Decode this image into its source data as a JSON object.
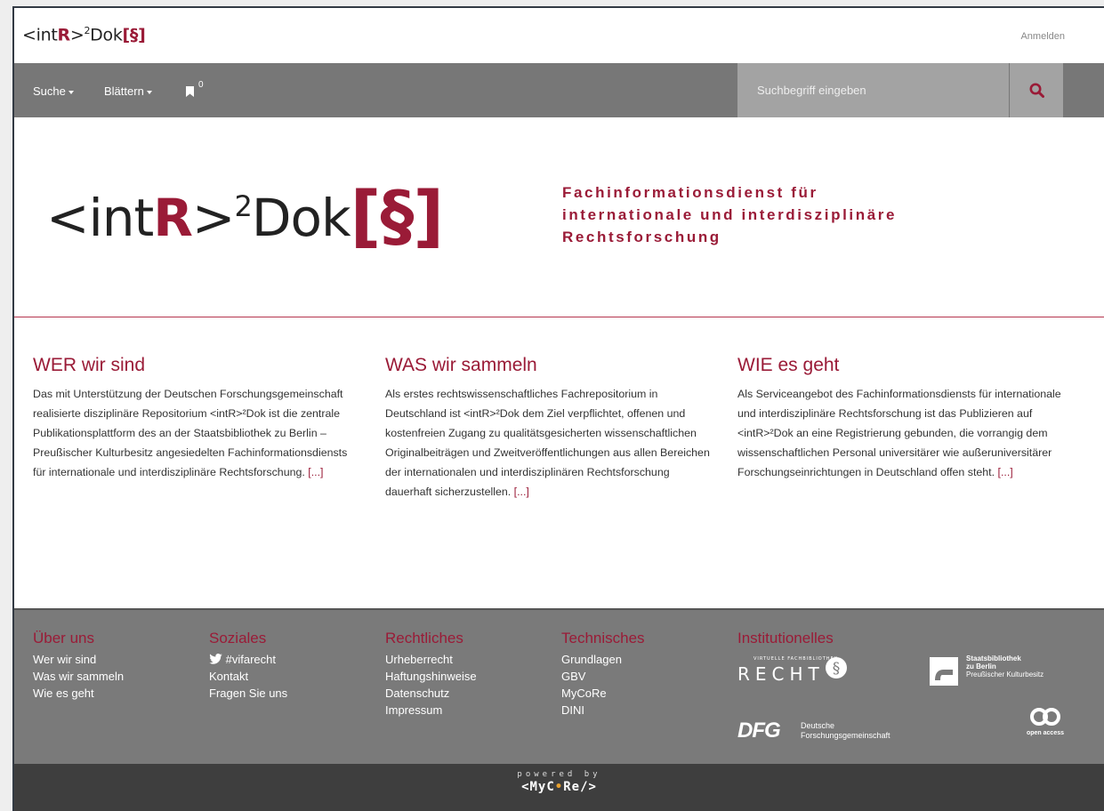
{
  "brand": {
    "pre": "<int",
    "r": "R",
    "gt": ">",
    "sup": "2",
    "dok": "Dok",
    "section": "[§]"
  },
  "header": {
    "login_label": "Anmelden"
  },
  "nav": {
    "search_label": "Suche",
    "browse_label": "Blättern",
    "bookmark_count": "0",
    "search_placeholder": "Suchbegriff eingeben"
  },
  "hero": {
    "tagline_line1": "Fachinformationsdienst für",
    "tagline_line2": "internationale und interdisziplinäre",
    "tagline_line3": "Rechtsforschung"
  },
  "columns": [
    {
      "title": "WER wir sind",
      "text": "Das mit Unterstützung der Deutschen Forschungsgemein­schaft realisierte disziplinäre Repositorium <intR>²Dok ist die zentrale Publikationsplattform des an der Staatsbi­bliothek zu Berlin – Preußischer Kulturbesitz angesiedel­ten Fachinformationsdiensts für internationale und inter­disziplinäre Rechtsforschung.",
      "more": "[...]"
    },
    {
      "title": "WAS wir sammeln",
      "text": "Als erstes rechtswissenschaftliches Fachrepositorium in Deutschland ist <intR>²Dok dem Ziel verpflichtet, offenen und kostenfreien Zugang zu qualitätsgesicherten wissen­schaftlichen Originalbeiträgen und Zweitveröffentlichun­gen aus allen Bereichen der internationalen und interdis­ziplinären Rechtsforschung dauerhaft sicherzustellen.",
      "more": "[...]"
    },
    {
      "title": "WIE es geht",
      "text": "Als Serviceangebot des Fachinformationsdiensts für inter­nationale und interdisziplinäre Rechtsforschung ist das Publizieren auf <intR>²Dok an eine Registrierung gebun­den, die vorrangig dem wissenschaftlichen Personal uni­versitärer wie außeruniversitärer Forschungseinrichtun­gen in Deutschland offen steht.",
      "more": "[...]"
    }
  ],
  "footer": {
    "about": {
      "title": "Über uns",
      "links": [
        "Wer wir sind",
        "Was wir sammeln",
        "Wie es geht"
      ]
    },
    "social": {
      "title": "Soziales",
      "twitter": "#vifarecht",
      "links": [
        "Kontakt",
        "Fragen Sie uns"
      ]
    },
    "legal": {
      "title": "Rechtliches",
      "links": [
        "Urheberrecht",
        "Haftungshinweise",
        "Datenschutz",
        "Impressum"
      ]
    },
    "tech": {
      "title": "Technisches",
      "links": [
        "Grundlagen",
        "GBV",
        "MyCoRe",
        "DINI"
      ]
    },
    "inst": {
      "title": "Institutionelles",
      "recht_small": "VIRTUELLE FACHBIBLIOTHEK",
      "recht": "RECHT",
      "sbb_line1": "Staatsbibliothek",
      "sbb_line2": "zu Berlin",
      "sbb_line3": "Preußischer Kulturbesitz",
      "dfg": "DFG",
      "dfg_line1": "Deutsche",
      "dfg_line2": "Forschungsgemeinschaft",
      "oa": "open access"
    }
  },
  "powered": {
    "label": "powered by",
    "mycore_pre": "<MyC",
    "mycore_dot": "•",
    "mycore_post": "Re/>"
  },
  "colors": {
    "accent": "#9a1b37",
    "nav": "#777777",
    "footer": "#7a7a7a"
  }
}
